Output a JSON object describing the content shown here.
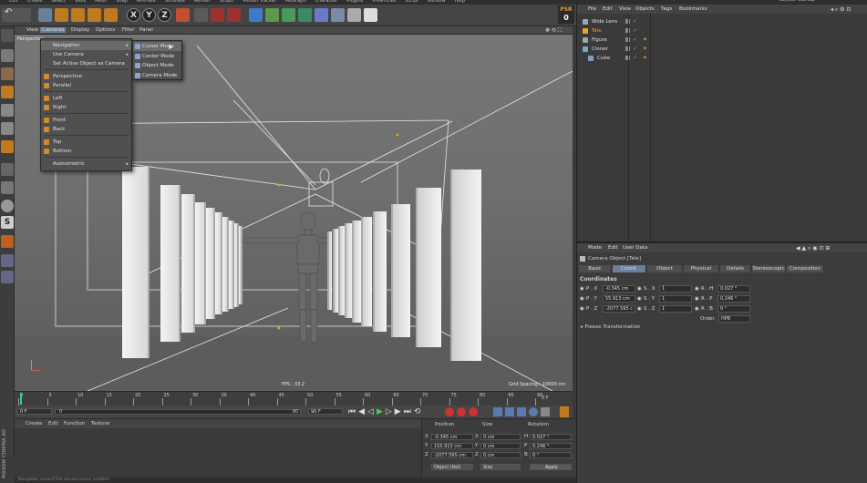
{
  "top_menu": [
    "Edit",
    "Create",
    "Select",
    "Tools",
    "Mesh",
    "Snap",
    "Animate",
    "Simulate",
    "Render",
    "Sculpt",
    "Motion Tracker",
    "MoGraph",
    "Character",
    "Plugins",
    "X-Particles",
    "Script",
    "Window",
    "Help"
  ],
  "layout": {
    "label": "Layout:",
    "value": "Startup"
  },
  "psr": {
    "label": "PSR",
    "value": "0"
  },
  "viewport": {
    "menu": [
      "View",
      "Cameras",
      "Display",
      "Options",
      "Filter",
      "Panel"
    ],
    "name": "Perspective",
    "fps": "FPS : 33.2",
    "grid_spacing": "Grid Spacing : 10000 cm"
  },
  "camera_menu": {
    "items": [
      {
        "label": "Navigation",
        "submenu": true,
        "highlight": true
      },
      {
        "label": "Use Camera",
        "submenu": true
      },
      {
        "label": "Set Active Object as Camera"
      },
      {
        "label": "Perspective",
        "icon": true
      },
      {
        "label": "Parallel",
        "icon": true
      },
      {
        "label": "Left",
        "icon": true
      },
      {
        "label": "Right",
        "icon": true
      },
      {
        "label": "Front",
        "icon": true
      },
      {
        "label": "Back",
        "icon": true
      },
      {
        "label": "Top",
        "icon": true
      },
      {
        "label": "Bottom",
        "icon": true
      },
      {
        "label": "Axonometric",
        "submenu": true
      }
    ]
  },
  "navigation_submenu": [
    "Cursor Mode",
    "Center Mode",
    "Object Mode",
    "Camera Mode"
  ],
  "timeline": {
    "ticks": [
      "0",
      "5",
      "10",
      "15",
      "20",
      "25",
      "30",
      "35",
      "40",
      "45",
      "50",
      "55",
      "60",
      "65",
      "70",
      "75",
      "80",
      "85",
      "90"
    ],
    "current_frame": "0 F",
    "start": "0 F",
    "range_start": "0",
    "range_end": "90",
    "end": "90 F"
  },
  "material_menu": [
    "Create",
    "Edit",
    "Function",
    "Texture"
  ],
  "coordinates": {
    "headers": [
      "Position",
      "Size",
      "Rotation"
    ],
    "rows": [
      {
        "axis": "X",
        "pos": "-0.345 cm",
        "size": "0 cm",
        "rl": "H",
        "rot": "0.027 °"
      },
      {
        "axis": "Y",
        "pos": "155.913 cm",
        "size": "0 cm",
        "rl": "P",
        "rot": "0.246 °"
      },
      {
        "axis": "Z",
        "pos": "-2077.595 cm",
        "size": "0 cm",
        "rl": "B",
        "rot": "0 °"
      }
    ],
    "mode": "Object (Rel)",
    "size_mode": "Size",
    "apply": "Apply"
  },
  "objects": {
    "menu": [
      "File",
      "Edit",
      "View",
      "Objects",
      "Tags",
      "Bookmarks"
    ],
    "rows": [
      {
        "name": "Wide Lens",
        "indent": 0,
        "color": "#9aa"
      },
      {
        "name": "Tele",
        "indent": 0,
        "color": "#f0a030"
      },
      {
        "name": "Figure",
        "indent": 0,
        "color": "#9aa"
      },
      {
        "name": "Cloner",
        "indent": 0,
        "color": "#7ab"
      },
      {
        "name": "Cube",
        "indent": 1,
        "color": "#7aa0c8"
      }
    ]
  },
  "attributes": {
    "menu": [
      "Mode",
      "Edit",
      "User Data"
    ],
    "title": "Camera Object [Tele]",
    "tabs": [
      "Basic",
      "Coord.",
      "Object",
      "Physical",
      "Details",
      "Stereoscopic",
      "Composition"
    ],
    "active_tab": 1,
    "section": "Coordinates",
    "rows": [
      {
        "p": "P . X",
        "pv": "-0.345 cm",
        "s": "S . X",
        "sv": "1",
        "r": "R . H",
        "rv": "0.027 °"
      },
      {
        "p": "P . Y",
        "pv": "55.913 cm",
        "s": "S . Y",
        "sv": "1",
        "r": "R . P",
        "rv": "0.246 °"
      },
      {
        "p": "P . Z",
        "pv": "-2077.595 c",
        "s": "S . Z",
        "sv": "1",
        "r": "R . B",
        "rv": "0 °"
      }
    ],
    "order_label": "Order",
    "order_value": "HPB",
    "freeze": "▸ Freeze Transformation"
  },
  "status": "Navigates around the mouse cursor position",
  "brand": "MAXON CINEMA 4D"
}
